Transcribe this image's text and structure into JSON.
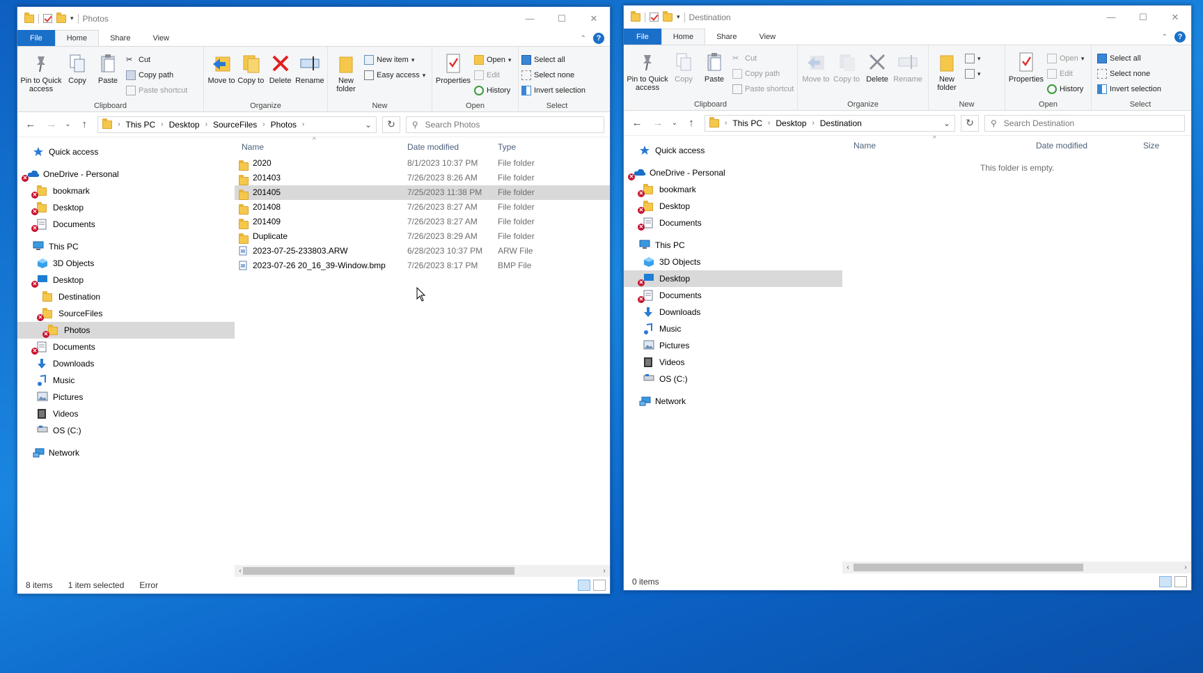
{
  "icons": {
    "quick_access": "star-icon",
    "onedrive": "cloud-icon",
    "folder": "folder-icon",
    "error": "error-x-icon"
  },
  "w1": {
    "title": "Photos",
    "tabs": {
      "file": "File",
      "home": "Home",
      "share": "Share",
      "view": "View"
    },
    "ribbon": {
      "pin": "Pin to Quick access",
      "copy": "Copy",
      "paste": "Paste",
      "cut": "Cut",
      "copy_path": "Copy path",
      "paste_shortcut": "Paste shortcut",
      "clipboard": "Clipboard",
      "move_to": "Move to",
      "copy_to": "Copy to",
      "delete": "Delete",
      "rename": "Rename",
      "organize": "Organize",
      "new_folder": "New folder",
      "new_item": "New item",
      "easy_access": "Easy access",
      "new": "New",
      "properties": "Properties",
      "open": "Open",
      "edit": "Edit",
      "history": "History",
      "open_group": "Open",
      "select_all": "Select all",
      "select_none": "Select none",
      "invert_selection": "Invert selection",
      "select": "Select"
    },
    "path": [
      "This PC",
      "Desktop",
      "SourceFiles",
      "Photos"
    ],
    "search_placeholder": "Search Photos",
    "nav": [
      "Quick access",
      "OneDrive - Personal",
      "bookmark",
      "Desktop",
      "Documents",
      "This PC",
      "3D Objects",
      "Desktop",
      "Destination",
      "SourceFiles",
      "Photos",
      "Documents",
      "Downloads",
      "Music",
      "Pictures",
      "Videos",
      "OS (C:)",
      "Network"
    ],
    "columns": {
      "name": "Name",
      "date": "Date modified",
      "type": "Type"
    },
    "files": [
      {
        "name": "2020",
        "date": "8/1/2023 10:37 PM",
        "type": "File folder"
      },
      {
        "name": "201403",
        "date": "7/26/2023 8:26 AM",
        "type": "File folder"
      },
      {
        "name": "201405",
        "date": "7/25/2023 11:38 PM",
        "type": "File folder"
      },
      {
        "name": "201408",
        "date": "7/26/2023 8:27 AM",
        "type": "File folder"
      },
      {
        "name": "201409",
        "date": "7/26/2023 8:27 AM",
        "type": "File folder"
      },
      {
        "name": "Duplicate",
        "date": "7/26/2023 8:29 AM",
        "type": "File folder"
      },
      {
        "name": "2023-07-25-233803.ARW",
        "date": "6/28/2023 10:37 PM",
        "type": "ARW File"
      },
      {
        "name": "2023-07-26 20_16_39-Window.bmp",
        "date": "7/26/2023 8:17 PM",
        "type": "BMP File"
      }
    ],
    "status": {
      "items": "8 items",
      "selected": "1 item selected",
      "error": "Error"
    }
  },
  "w2": {
    "title": "Destination",
    "tabs": {
      "file": "File",
      "home": "Home",
      "share": "Share",
      "view": "View"
    },
    "ribbon": {
      "pin": "Pin to Quick access",
      "copy": "Copy",
      "paste": "Paste",
      "cut": "Cut",
      "copy_path": "Copy path",
      "paste_shortcut": "Paste shortcut",
      "clipboard": "Clipboard",
      "move_to": "Move to",
      "copy_to": "Copy to",
      "delete": "Delete",
      "rename": "Rename",
      "organize": "Organize",
      "new_folder": "New folder",
      "new": "New",
      "properties": "Properties",
      "open": "Open",
      "edit": "Edit",
      "history": "History",
      "open_group": "Open",
      "select_all": "Select all",
      "select_none": "Select none",
      "invert_selection": "Invert selection",
      "select": "Select"
    },
    "path": [
      "This PC",
      "Desktop",
      "Destination"
    ],
    "search_placeholder": "Search Destination",
    "nav": [
      "Quick access",
      "OneDrive - Personal",
      "bookmark",
      "Desktop",
      "Documents",
      "This PC",
      "3D Objects",
      "Desktop",
      "Documents",
      "Downloads",
      "Music",
      "Pictures",
      "Videos",
      "OS (C:)",
      "Network"
    ],
    "columns": {
      "name": "Name",
      "date": "Date modified",
      "size": "Size"
    },
    "empty": "This folder is empty.",
    "status": {
      "items": "0 items"
    }
  }
}
